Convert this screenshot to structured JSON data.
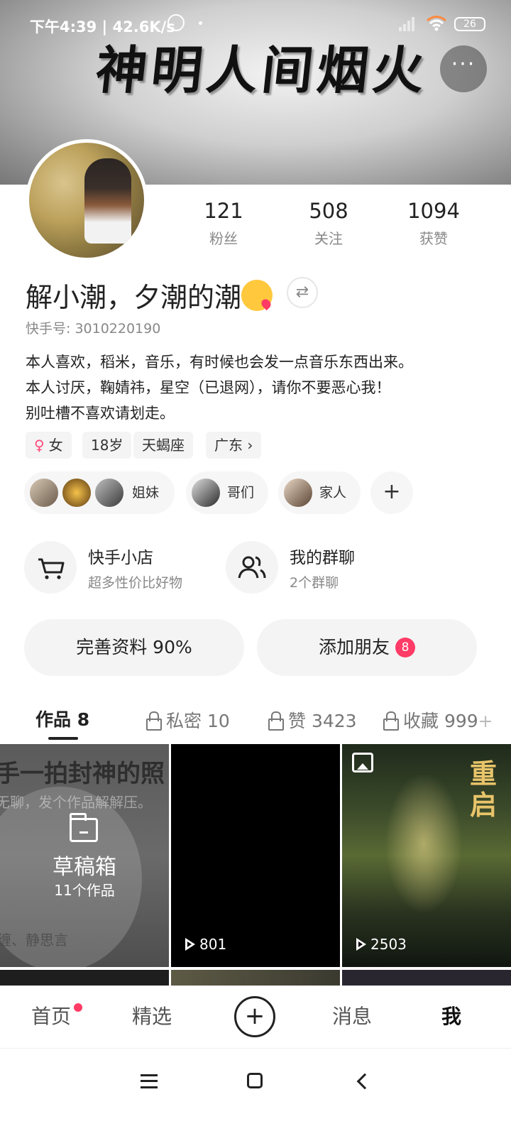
{
  "status_bar": {
    "time": "下午4:39",
    "speed": "42.6K/s",
    "battery": "26"
  },
  "banner": {
    "title": "神明人间烟火",
    "more_label": "···"
  },
  "profile": {
    "stats": [
      {
        "value": "121",
        "label": "粉丝"
      },
      {
        "value": "508",
        "label": "关注"
      },
      {
        "value": "1094",
        "label": "获赞"
      }
    ],
    "username": "解小潮，夕潮的潮",
    "switch_label": "⇄",
    "uid": "快手号: 3010220190",
    "bio": [
      "本人喜欢，稻米，音乐，有时候也会发一点音乐东西出来。",
      "本人讨厌，鞠婧祎，星空（已退网），请你不要恶心我！",
      "别吐槽不喜欢请划走。"
    ],
    "tags": {
      "gender": "女",
      "age": "18岁",
      "zodiac": "天蝎座",
      "location": "广东 ›"
    },
    "groups": [
      {
        "label": "姐妹"
      },
      {
        "label": "哥们"
      },
      {
        "label": "家人"
      }
    ],
    "add_group": "+"
  },
  "features": {
    "shop": {
      "title": "快手小店",
      "subtitle": "超多性价比好物"
    },
    "group_chat": {
      "title": "我的群聊",
      "subtitle": "2个群聊"
    }
  },
  "actions": {
    "complete_profile": "完善资料 90%",
    "add_friends": "添加朋友",
    "add_friends_badge": "8"
  },
  "tabs": {
    "works": "作品 8",
    "private": "私密 10",
    "likes": "赞 3423",
    "favorites": "收藏 999",
    "favorites_plus": "+"
  },
  "grid": {
    "draft_bg_line1": "手一拍封神的照",
    "draft_bg_line2": "无聊，发个作品解解压。",
    "draft_bg_line3": "缠、静思言",
    "draft_title": "草稿箱",
    "draft_count": "11个作品",
    "video1_plays": "801",
    "video2_plays": "2503",
    "poster_title": "重启"
  },
  "bottom_nav": {
    "home": "首页",
    "featured": "精选",
    "create": "+",
    "messages": "消息",
    "me": "我"
  },
  "colors": {
    "accent": "#ff3b66",
    "text": "#222222",
    "muted": "#888888",
    "chip_bg": "#f4f4f4"
  }
}
